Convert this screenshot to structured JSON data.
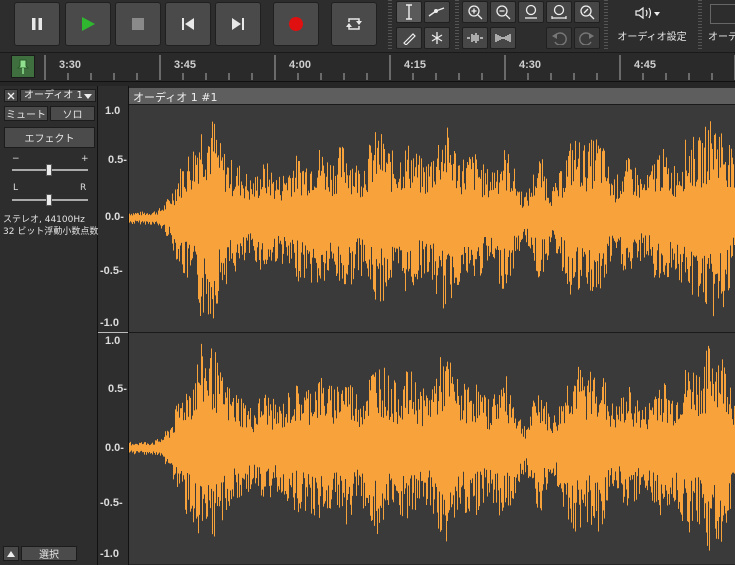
{
  "toolbar": {
    "pause_icon": "pause-icon",
    "play_icon": "play-icon",
    "stop_icon": "stop-icon",
    "skip_start_icon": "skip-to-start-icon",
    "skip_end_icon": "skip-to-end-icon",
    "record_icon": "record-icon",
    "loop_icon": "loop-icon",
    "audio_settings_label": "オーディオ設定",
    "share_label_partial": "オーデ",
    "colors": {
      "play": "#2fb82f",
      "record": "#e01010"
    }
  },
  "timeline": {
    "ticks": [
      "3:30",
      "3:45",
      "4:00",
      "4:15",
      "4:30",
      "4:45"
    ]
  },
  "track": {
    "name": "オーディオ 1",
    "clip_title": "オーディオ 1 #1",
    "mute_label": "ミュート",
    "solo_label": "ソロ",
    "effects_label": "エフェクト",
    "gain_minus": "−",
    "gain_plus": "+",
    "pan_left": "L",
    "pan_right": "R",
    "info_line1": "ステレオ, 44100Hz",
    "info_line2": "32 ビット浮動小数点数",
    "select_label": "選択"
  },
  "scale": {
    "ch1": [
      "1.0",
      "0.5-",
      "0.0-",
      "-0.5-",
      "-1.0"
    ],
    "ch2": [
      "1.0",
      "0.5-",
      "0.0-",
      "-0.5-",
      "-1.0"
    ]
  },
  "waveform_color": "#f7a23a"
}
